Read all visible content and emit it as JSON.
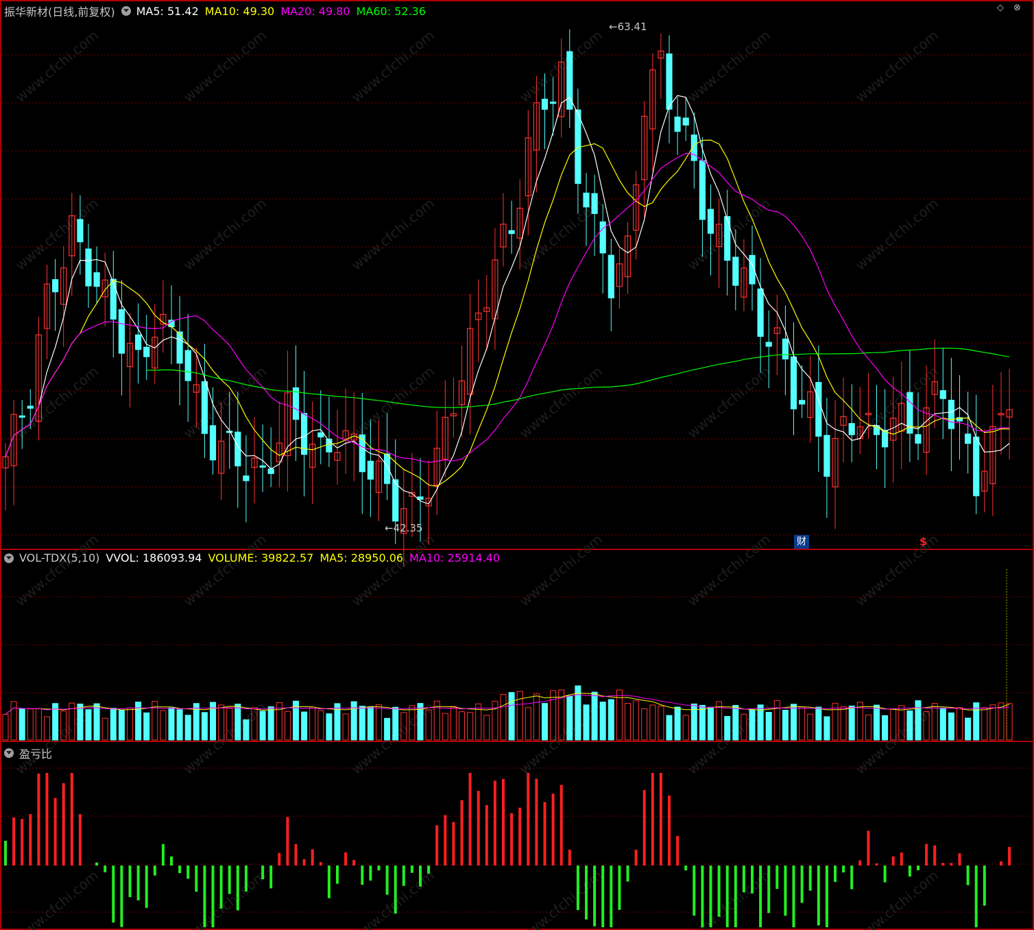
{
  "main_panel": {
    "title": "振华新材(日线,前复权)",
    "indicators": [
      {
        "label": "MA5: 51.42",
        "color": "#ffffff"
      },
      {
        "label": "MA10: 49.30",
        "color": "#ffff00"
      },
      {
        "label": "MA20: 49.80",
        "color": "#ff00ff"
      },
      {
        "label": "MA60: 52.36",
        "color": "#00ff00"
      }
    ],
    "high_marker": "63.41",
    "low_marker": "42.35",
    "event_cai": "财",
    "event_s": "$",
    "corner_icons": [
      "diamond-icon",
      "close-circle-icon"
    ]
  },
  "vol_panel": {
    "title": "VOL-TDX(5,10)",
    "indicators": [
      {
        "label": "VVOL: 186093.94",
        "color": "#ffffff"
      },
      {
        "label": "VOLUME: 39822.57",
        "color": "#ffff00"
      },
      {
        "label": "MA5: 28950.06",
        "color": "#ffff00"
      },
      {
        "label": "MA10: 25914.40",
        "color": "#ff00ff"
      }
    ]
  },
  "pl_panel": {
    "title": "盈亏比"
  },
  "watermark": "www.cfchi.com",
  "colors": {
    "up": "#ff3232",
    "down": "#54ffff",
    "ma5": "#ffffff",
    "ma10": "#ffff00",
    "ma20": "#ff00ff",
    "ma60": "#00ff00",
    "border": "#b00000",
    "grid": "#7a0000",
    "pl_pos": "#ff2020",
    "pl_neg": "#22ee22"
  },
  "chart_data": {
    "type": "candlestick",
    "price_range": [
      42.35,
      63.41
    ],
    "ma_last": {
      "MA5": 51.42,
      "MA10": 49.3,
      "MA20": 49.8,
      "MA60": 52.36
    },
    "volume_last": {
      "VVOL": 186093.94,
      "VOLUME": 39822.57,
      "MA5": 28950.06,
      "MA10": 25914.4
    }
  }
}
